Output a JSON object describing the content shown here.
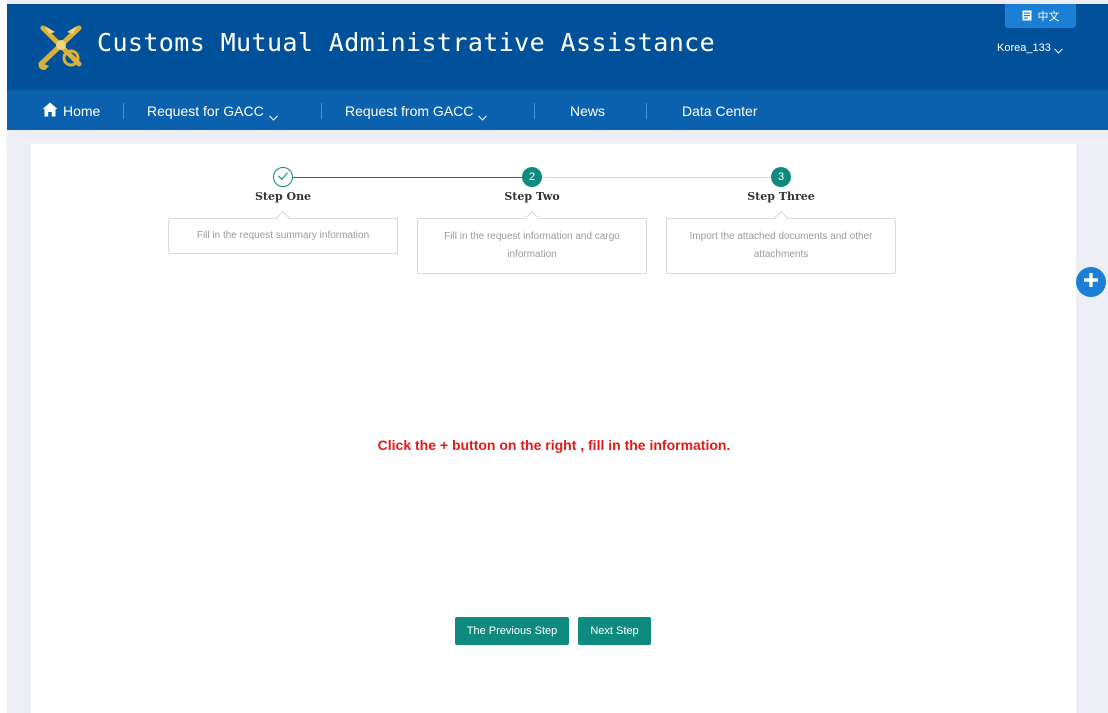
{
  "header": {
    "title": "Customs Mutual Administrative Assistance",
    "lang_button": "中文",
    "user": "Korea_133"
  },
  "nav": {
    "items": [
      {
        "label": "Home",
        "icon": "home-icon"
      },
      {
        "label": "Request for GACC",
        "dropdown": true
      },
      {
        "label": "Request from GACC",
        "dropdown": true
      },
      {
        "label": "News"
      },
      {
        "label": "Data Center"
      }
    ]
  },
  "steps": [
    {
      "title": "Step One",
      "number": "",
      "status": "done",
      "description": "Fill in the request summary information"
    },
    {
      "title": "Step Two",
      "number": "2",
      "status": "todo",
      "description": "Fill in the request information and cargo information"
    },
    {
      "title": "Step Three",
      "number": "3",
      "status": "todo",
      "description": "Import the attached documents and other attachments"
    }
  ],
  "main": {
    "hint": "Click the + button on the right , fill in the information."
  },
  "buttons": {
    "previous": "The Previous Step",
    "next": "Next Step"
  },
  "colors": {
    "header_bg": "#00509a",
    "nav_bg": "#0b61ad",
    "accent_teal": "#0f8a7e",
    "hint_red": "#e31a1a",
    "fab_blue": "#1b7fd6"
  }
}
